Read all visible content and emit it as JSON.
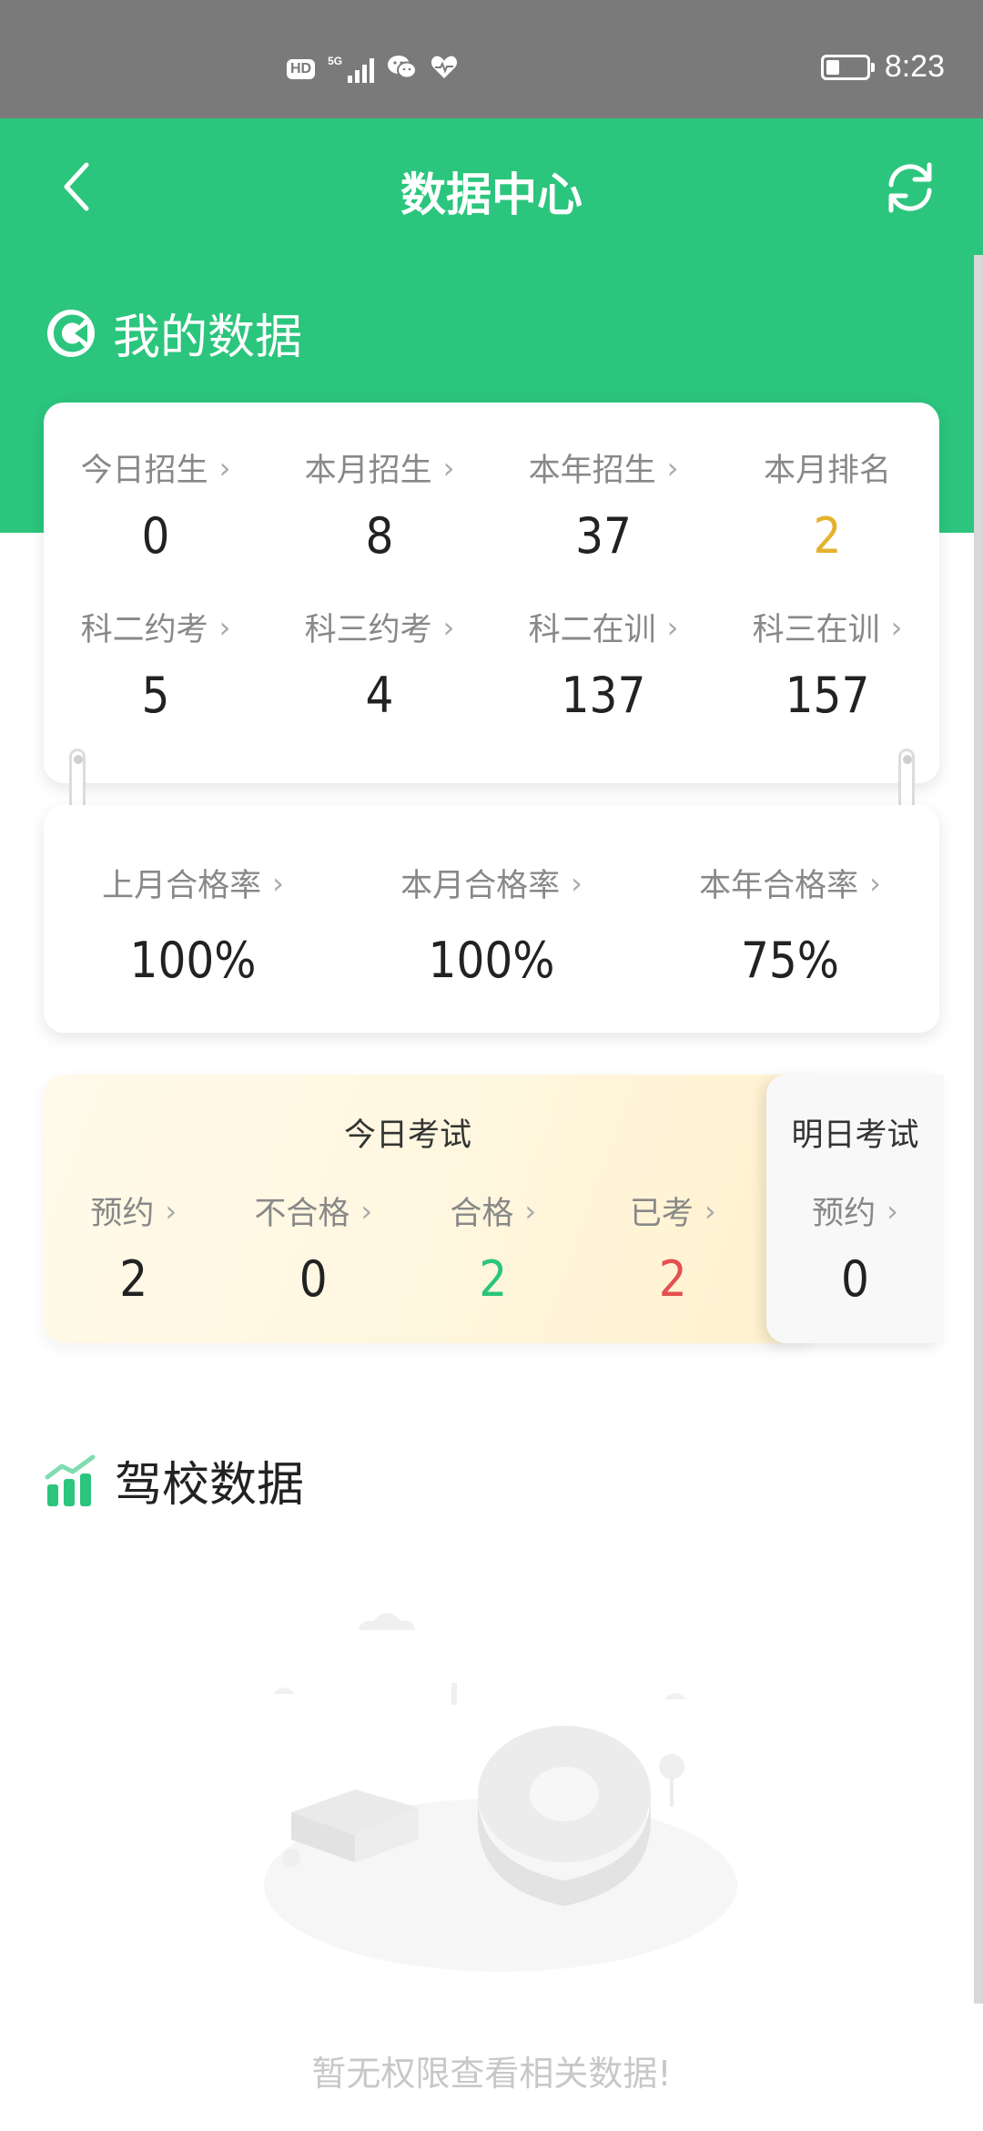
{
  "status_bar": {
    "hd": "HD",
    "network": "5G",
    "time": "8:23",
    "icons": [
      "hd-icon",
      "signal-icon",
      "wechat-icon",
      "health-icon",
      "battery-icon"
    ]
  },
  "nav": {
    "title": "数据中心",
    "back_icon": "back-chevron-icon",
    "refresh_icon": "refresh-icon"
  },
  "my_data": {
    "title": "我的数据",
    "row1": [
      {
        "label": "今日招生",
        "value": "0",
        "arrow": true
      },
      {
        "label": "本月招生",
        "value": "8",
        "arrow": true
      },
      {
        "label": "本年招生",
        "value": "37",
        "arrow": true
      },
      {
        "label": "本月排名",
        "value": "2",
        "arrow": false
      }
    ],
    "row2": [
      {
        "label": "科二约考",
        "value": "5",
        "arrow": true
      },
      {
        "label": "科三约考",
        "value": "4",
        "arrow": true
      },
      {
        "label": "科二在训",
        "value": "137",
        "arrow": true
      },
      {
        "label": "科三在训",
        "value": "157",
        "arrow": true
      }
    ],
    "pass_rates": [
      {
        "label": "上月合格率",
        "value": "100%"
      },
      {
        "label": "本月合格率",
        "value": "100%"
      },
      {
        "label": "本年合格率",
        "value": "75%"
      }
    ]
  },
  "exam_today": {
    "title": "今日考试",
    "items": [
      {
        "label": "预约",
        "value": "2"
      },
      {
        "label": "不合格",
        "value": "0"
      },
      {
        "label": "合格",
        "value": "2"
      },
      {
        "label": "已考",
        "value": "2"
      }
    ]
  },
  "exam_tomorrow": {
    "title": "明日考试",
    "items": [
      {
        "label": "预约",
        "value": "0"
      }
    ]
  },
  "school_data": {
    "title": "驾校数据",
    "empty_message": "暂无权限查看相关数据!"
  },
  "colors": {
    "primary_green": "#2cc57d",
    "rank_gold": "#e6b22c",
    "pass_green": "#2cc57d",
    "taken_red": "#e45050"
  }
}
